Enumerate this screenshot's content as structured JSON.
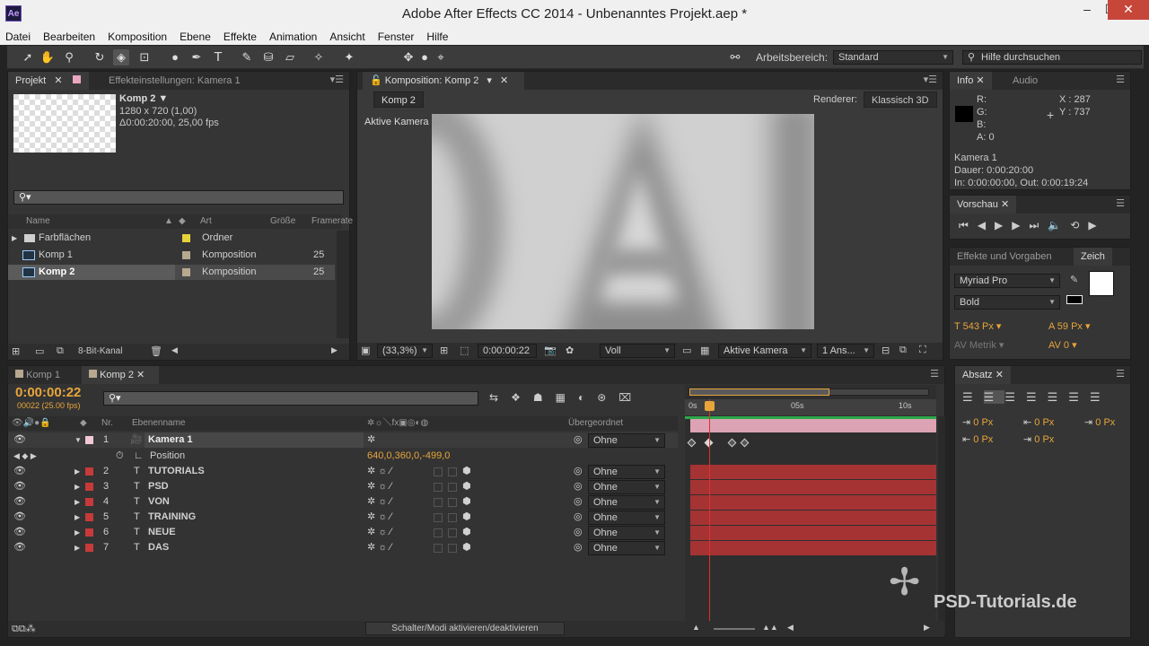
{
  "app": {
    "title": "Adobe After Effects CC 2014 - Unbenanntes Projekt.aep *",
    "logo_text": "Ae"
  },
  "menu": [
    "Datei",
    "Bearbeiten",
    "Komposition",
    "Ebene",
    "Effekte",
    "Animation",
    "Ansicht",
    "Fenster",
    "Hilfe"
  ],
  "toolbar": {
    "workspace_label": "Arbeitsbereich:",
    "workspace_value": "Standard",
    "search_placeholder": "Hilfe durchsuchen"
  },
  "project_panel": {
    "tabs": [
      "Projekt",
      "Effekteinstellungen: Kamera 1"
    ],
    "preview": {
      "name": "Komp 2 ▼",
      "line1": "1280 x 720 (1,00)",
      "line2": "Δ0:00:20:00, 25,00 fps"
    },
    "search_placeholder": "⚲▾",
    "columns": [
      "Name",
      "Art",
      "Größe",
      "Framerate"
    ],
    "items": [
      {
        "name": "Farbflächen",
        "type": "Ordner",
        "rate": "",
        "color": "#e6d23a"
      },
      {
        "name": "Komp 1",
        "type": "Komposition",
        "rate": "25",
        "color": "#b8a890"
      },
      {
        "name": "Komp 2",
        "type": "Komposition",
        "rate": "25",
        "color": "#b8a890"
      }
    ],
    "bitdepth": "8-Bit-Kanal"
  },
  "comp_panel": {
    "tab": "Komposition: Komp 2",
    "crumb": "Komp 2",
    "renderer_label": "Renderer:",
    "renderer_value": "Klassisch 3D",
    "camera_label": "Aktive Kamera",
    "zoom": "(33,3%)",
    "timecode": "0:00:00:22",
    "resolution": "Voll",
    "view": "Aktive Kamera",
    "views": "1 Ans..."
  },
  "info_panel": {
    "tabs": [
      "Info",
      "Audio"
    ],
    "r": "R:",
    "g": "G:",
    "b": "B:",
    "a": "A:  0",
    "x": "X : 287",
    "y": "Y : 737",
    "l1": "Kamera 1",
    "l2": "Dauer: 0:00:20:00",
    "l3": "In: 0:00:00:00, Out: 0:00:19:24"
  },
  "preview_panel": {
    "tab": "Vorschau"
  },
  "effects_panel": {
    "tabs": [
      "Effekte und Vorgaben",
      "Zeich"
    ],
    "font": "Myriad Pro",
    "style": "Bold",
    "size": "543 Px",
    "leading": "59 Px",
    "kerning": "Metrik",
    "tracking": "0"
  },
  "paragraph_panel": {
    "tab": "Absatz",
    "v1": "0 Px",
    "v2": "0 Px",
    "v3": "0 Px",
    "v4": "0 Px",
    "v5": "0 Px"
  },
  "timeline": {
    "tabs": [
      "Komp 1",
      "Komp 2"
    ],
    "timecode": "0:00:00:22",
    "frames": "00022 (25.00 fps)",
    "col_nr": "Nr.",
    "col_name": "Ebenenname",
    "col_parent": "Übergeordnet",
    "ruler": [
      "0s",
      "05s",
      "10s"
    ],
    "camera": {
      "nr": "1",
      "name": "Kamera 1",
      "parent": "Ohne",
      "prop": "Position",
      "value": "640,0,360,0,-499,0"
    },
    "layers": [
      {
        "nr": "2",
        "name": "TUTORIALS",
        "parent": "Ohne"
      },
      {
        "nr": "3",
        "name": "PSD",
        "parent": "Ohne"
      },
      {
        "nr": "4",
        "name": "VON",
        "parent": "Ohne"
      },
      {
        "nr": "5",
        "name": "TRAINING",
        "parent": "Ohne"
      },
      {
        "nr": "6",
        "name": "NEUE",
        "parent": "Ohne"
      },
      {
        "nr": "7",
        "name": "DAS",
        "parent": "Ohne"
      }
    ],
    "footer": "Schalter/Modi aktivieren/deaktivieren"
  },
  "watermark": "PSD-Tutorials.de"
}
